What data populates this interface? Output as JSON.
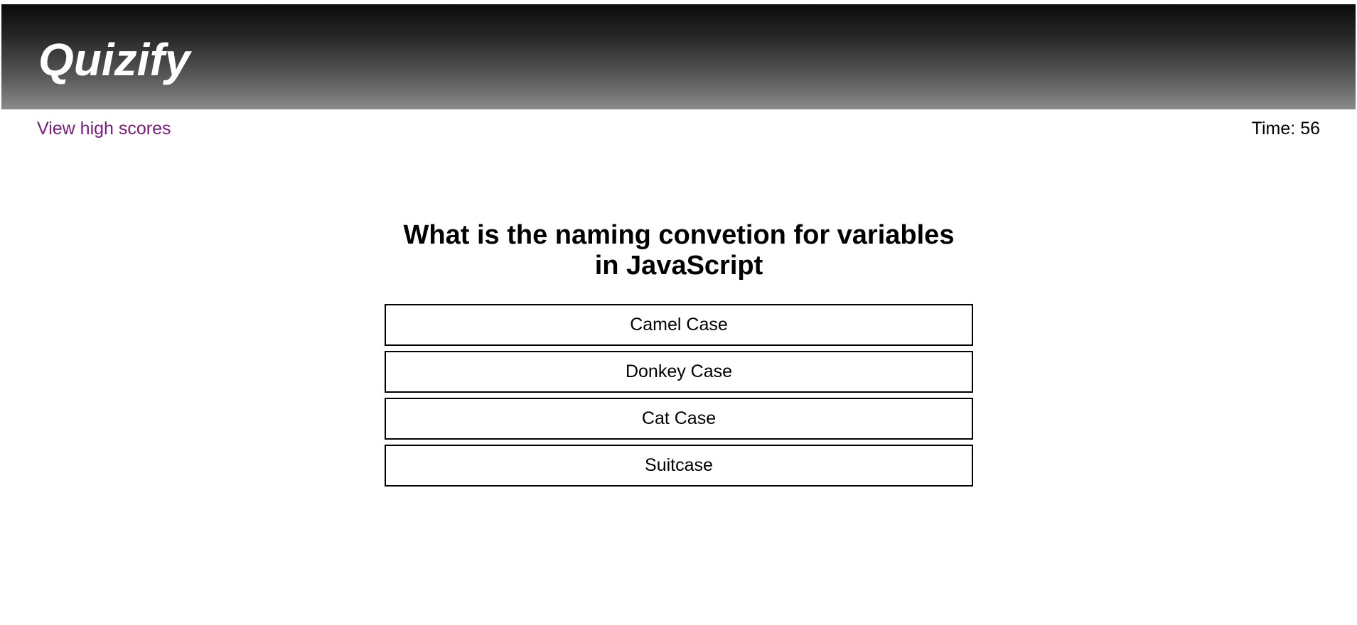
{
  "header": {
    "app_title": "Quizify"
  },
  "nav": {
    "high_scores_label": "View high scores",
    "timer_label": "Time:",
    "timer_value": "56"
  },
  "quiz": {
    "question": "What is the naming convetion for variables in JavaScript",
    "answers": [
      {
        "label": "Camel Case"
      },
      {
        "label": "Donkey Case"
      },
      {
        "label": "Cat Case"
      },
      {
        "label": "Suitcase"
      }
    ]
  },
  "colors": {
    "link": "#7b1a7e",
    "header_top": "#0b0b0b",
    "header_bottom": "#8a8a8a",
    "button_border": "#000000"
  }
}
